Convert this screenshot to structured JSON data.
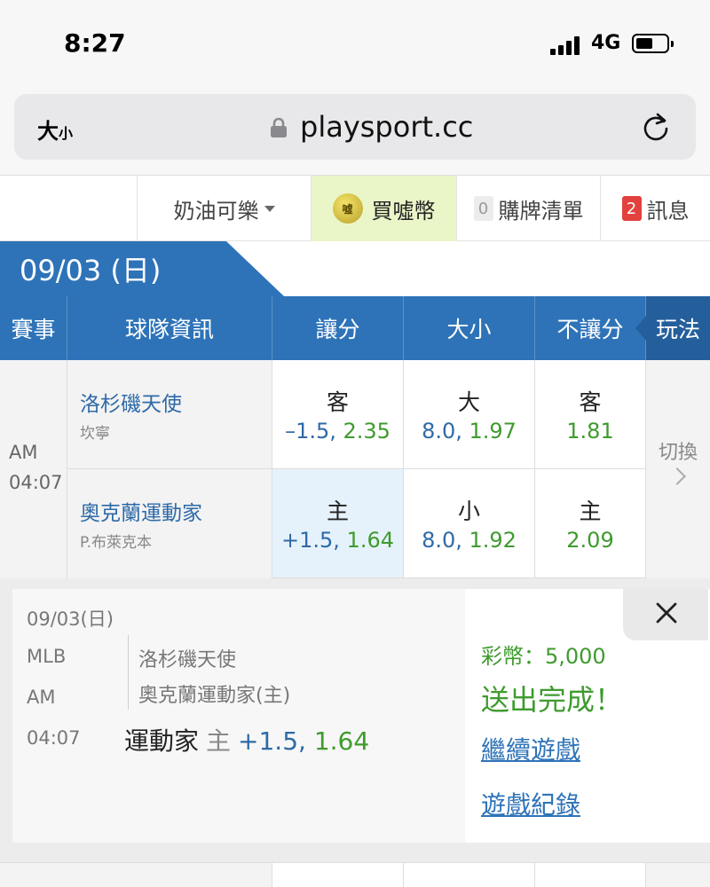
{
  "status_bar": {
    "time": "8:27",
    "network": "4G"
  },
  "browser": {
    "text_size_label": "大",
    "text_size_small": "小",
    "url": "playsport.cc"
  },
  "site_nav": {
    "user": "奶油可樂",
    "coin_icon_text": "噓",
    "buy_coins": "買噓幣",
    "cart_count": "0",
    "cart": "購牌清單",
    "msg_count": "2",
    "messages": "訊息"
  },
  "date_tab": "09/03 (日)",
  "table_header": {
    "event": "賽事",
    "team_info": "球隊資訊",
    "spread": "讓分",
    "total": "大小",
    "moneyline": "不讓分",
    "play": "玩法"
  },
  "game": {
    "ampm": "AM",
    "time": "04:07",
    "switch_label": "切換",
    "away": {
      "name": "洛杉磯天使",
      "pitcher": "坎寧",
      "spread_side": "客",
      "spread_odds": "–1.5,",
      "spread_price": "2.35",
      "total_side": "大",
      "total_odds": "8.0,",
      "total_price": "1.97",
      "ml_side": "客",
      "ml_price": "1.81"
    },
    "home": {
      "name": "奧克蘭運動家",
      "pitcher": "P.布萊克本",
      "spread_side": "主",
      "spread_odds": "+1.5,",
      "spread_price": "1.64",
      "total_side": "小",
      "total_odds": "8.0,",
      "total_price": "1.92",
      "ml_side": "主",
      "ml_price": "2.09"
    }
  },
  "confirmation": {
    "date": "09/03(日)",
    "league": "MLB",
    "ampm": "AM",
    "time": "04:07",
    "away": "洛杉磯天使",
    "home": "奧克蘭運動家(主)",
    "pick_team": "運動家",
    "pick_side": "主",
    "pick_odds": "+1.5,",
    "pick_price": "1.64",
    "coins": "彩幣：5,000",
    "sent": "送出完成！",
    "continue_link": "繼續遊戲",
    "record_link": "遊戲紀錄"
  },
  "colors": {
    "brand_blue": "#2e73b8",
    "odds_blue": "#2e6aa8",
    "odds_green": "#3f9b2e",
    "badge_red": "#e2413e",
    "coin_bg": "#eaf6c8",
    "selected_cell": "#e6f2fb"
  },
  "icons": [
    "signal-icon",
    "battery-icon",
    "lock-icon",
    "reload-icon",
    "caret-down-icon",
    "coin-icon",
    "chevron-right-icon",
    "close-icon"
  ]
}
